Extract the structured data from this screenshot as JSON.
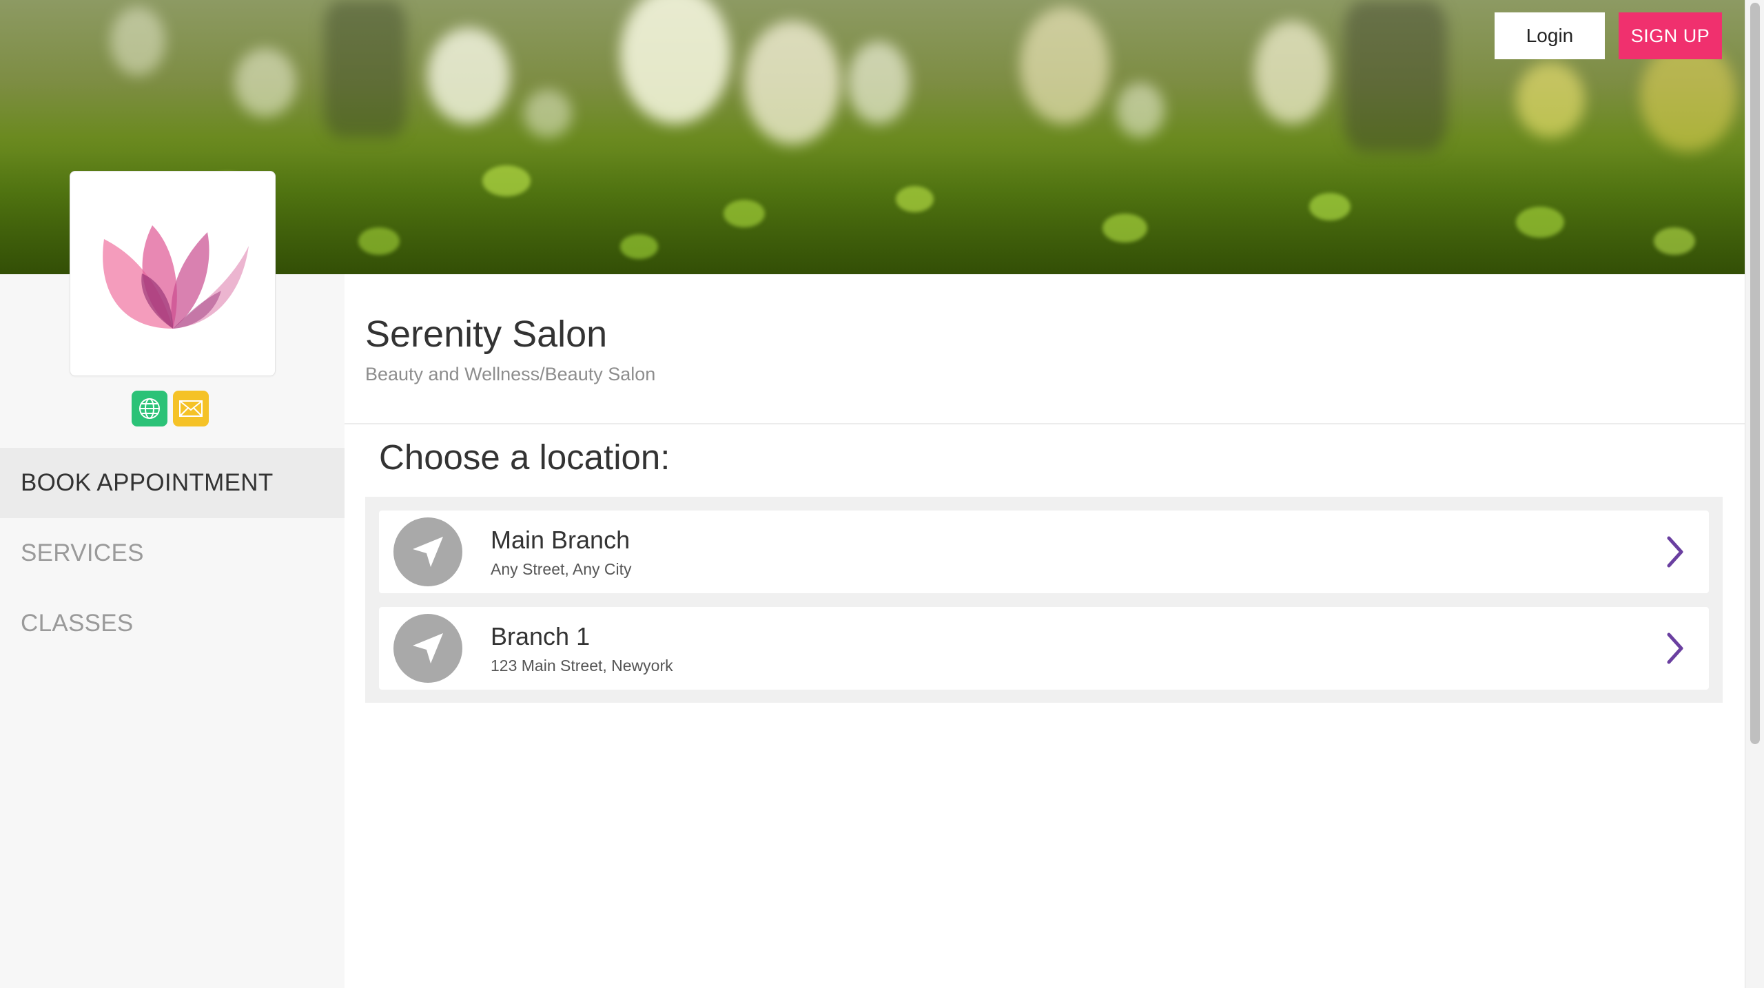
{
  "header": {
    "login_label": "Login",
    "signup_label": "SIGN UP"
  },
  "business": {
    "name": "Serenity Salon",
    "category": "Beauty and Wellness/Beauty Salon"
  },
  "social": {
    "website_icon": "globe-icon",
    "email_icon": "envelope-icon"
  },
  "nav": {
    "items": [
      {
        "label": "BOOK APPOINTMENT",
        "active": true
      },
      {
        "label": "SERVICES",
        "active": false
      },
      {
        "label": "CLASSES",
        "active": false
      }
    ]
  },
  "main": {
    "choose_label": "Choose a location:",
    "locations": [
      {
        "name": "Main Branch",
        "address": "Any Street, Any City"
      },
      {
        "name": "Branch 1",
        "address": "123 Main Street, Newyork"
      }
    ]
  },
  "colors": {
    "signup": "#f0306e",
    "website_icon_bg": "#2bc277",
    "email_icon_bg": "#f5c227",
    "chevron": "#6a3fa0",
    "location_icon_bg": "#a9a9a9"
  }
}
